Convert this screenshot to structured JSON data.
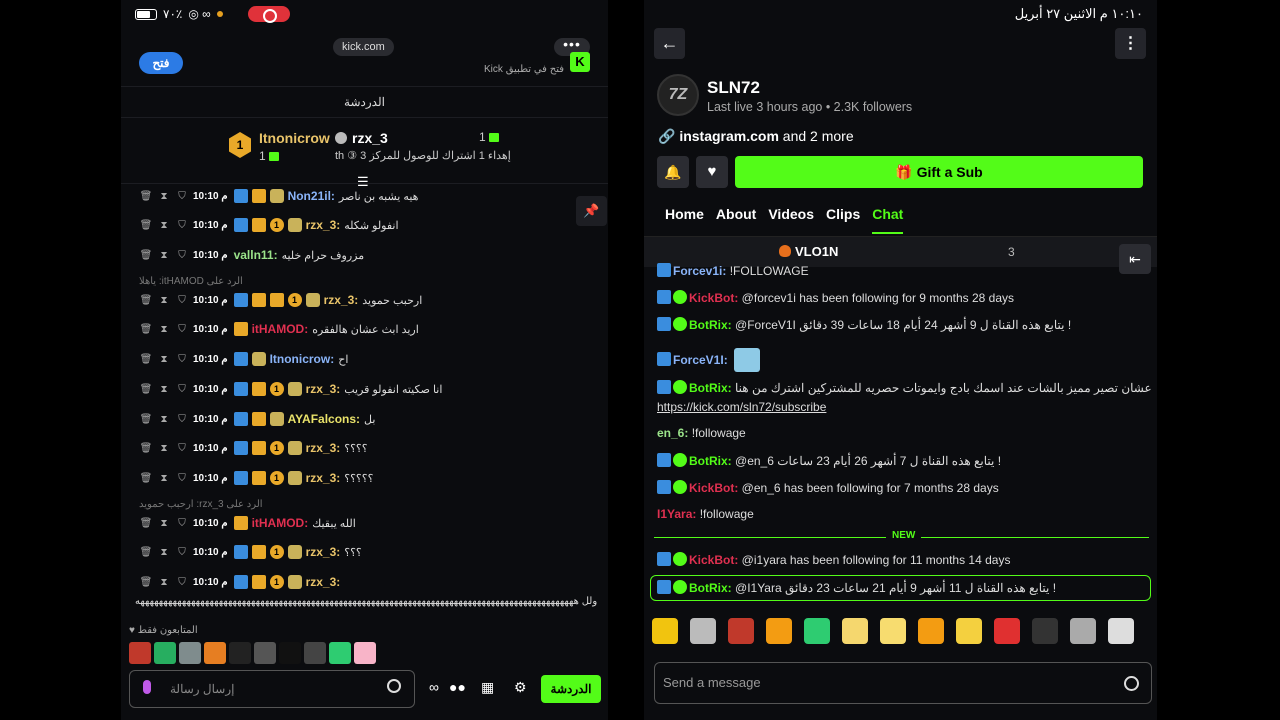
{
  "left": {
    "status": {
      "battery_text": "٧٠٪"
    },
    "url": "kick.com",
    "open_button": "فتح",
    "app_banner": "فتح في تطبيق Kick",
    "chat_title": "الدردشة",
    "gift": {
      "rank": "1",
      "top_user": "Itnonicrow",
      "top_count": "1",
      "second_user": "rzx_3",
      "second_count": "1",
      "desc": "إهداء 1 اشتراك للوصول للمركز 3 ③ th"
    },
    "messages": [
      {
        "time": "10:10 م",
        "user": "Non21il:",
        "color": "#8ab4f8",
        "text": "هيه يشبه بن ناصر"
      },
      {
        "time": "10:10 م",
        "user": "rzx_3:",
        "color": "#e9c46a",
        "text": "انفولو شكله"
      },
      {
        "time": "10:10 م",
        "user": "valln11:",
        "color": "#9be38a",
        "text": "مزروف حرام خليه"
      },
      {
        "time": "10:10 م",
        "user": "rzx_3:",
        "color": "#e9c46a",
        "text": "ارحبب حمويد"
      },
      {
        "time": "10:10 م",
        "user": "itHAMOD:",
        "color": "#e03050",
        "text": "اريد ابث عشان هالفقره"
      },
      {
        "time": "10:10 م",
        "user": "Itnonicrow:",
        "color": "#8ab4f8",
        "text": "اح"
      },
      {
        "time": "10:10 م",
        "user": "rzx_3:",
        "color": "#e9c46a",
        "text": "انا صكيته انفولو قريب"
      },
      {
        "time": "10:10 م",
        "user": "AYAFalcons:",
        "color": "#e9e26a",
        "text": "بل"
      },
      {
        "time": "10:10 م",
        "user": "rzx_3:",
        "color": "#e9c46a",
        "text": "؟؟؟؟"
      },
      {
        "time": "10:10 م",
        "user": "rzx_3:",
        "color": "#e9c46a",
        "text": "؟؟؟؟؟"
      },
      {
        "time": "10:10 م",
        "user": "itHAMOD:",
        "color": "#e03050",
        "text": "الله يبقيك"
      },
      {
        "time": "10:10 م",
        "user": "rzx_3:",
        "color": "#e9c46a",
        "text": "؟؟؟"
      },
      {
        "time": "10:10 م",
        "user": "rzx_3:",
        "color": "#e9c46a",
        "text": ""
      }
    ],
    "reply1": "الرد على itHAMOD: ياهلا",
    "reply2": "الرد على rzx_3: ارحبب حمويد",
    "long_text": "ولل هههههههههههههههههههههههههههههههههههههههههههههههههههههههههههههههههههههههههههههههههههههههههههههههه",
    "followers_only": "المتابعون فقط",
    "input_placeholder": "إرسال رسالة",
    "chat_button": "الدردشة"
  },
  "right": {
    "status_time": "١٠:١٠ م   الاثنين ٢٧ أبريل",
    "channel": {
      "avatar_text": "7Z",
      "name": "SLN72",
      "meta": "Last live 3 hours ago • 2.3K followers",
      "link": "instagram.com",
      "link_more": " and 2 more"
    },
    "gift_sub": "Gift a Sub",
    "tabs": [
      "Home",
      "About",
      "Videos",
      "Clips",
      "Chat"
    ],
    "pinned_user": "VLO1N",
    "pinned_count": "3",
    "messages": [
      {
        "user": "Forcev1i:",
        "color": "#8ab4f8",
        "text": " !FOLLOWAGE"
      },
      {
        "user": "KickBot:",
        "color": "#e03050",
        "text": " @forcev1i has been following for 9 months 28 days"
      },
      {
        "user": "BotRix:",
        "color": "#53fc18",
        "text": " @ForceV1I يتابع هذه القناة ل 9 أشهر 24 أيام 18 ساعات 39 دقائق !"
      },
      {
        "user": "ForceV1I:",
        "color": "#8ab4f8",
        "text": ""
      },
      {
        "user": "BotRix:",
        "color": "#53fc18",
        "text": " عشان تصير مميز بالشات عند اسمك بادج وايموتات حصريه للمشتركين اشترك من هنا"
      },
      {
        "user": "",
        "color": "#fff",
        "text": "https://kick.com/sln72/subscribe"
      },
      {
        "user": "en_6:",
        "color": "#9be38a",
        "text": " !followage"
      },
      {
        "user": "BotRix:",
        "color": "#53fc18",
        "text": " @en_6 يتابع هذه القناة ل 7 أشهر 26 أيام 23 ساعات !"
      },
      {
        "user": "KickBot:",
        "color": "#e03050",
        "text": " @en_6 has been following for 7 months 28 days"
      },
      {
        "user": "I1Yara:",
        "color": "#e03050",
        "text": " !followage"
      },
      {
        "user": "KickBot:",
        "color": "#e03050",
        "text": " @i1yara has been following for 11 months 14 days"
      },
      {
        "user": "BotRix:",
        "color": "#53fc18",
        "text": " @I1Yara يتابع هذه القناة ل 11 أشهر 9 أيام 21 ساعات 23 دقائق !"
      }
    ],
    "new_label": "NEW",
    "input_placeholder": "Send a message"
  }
}
